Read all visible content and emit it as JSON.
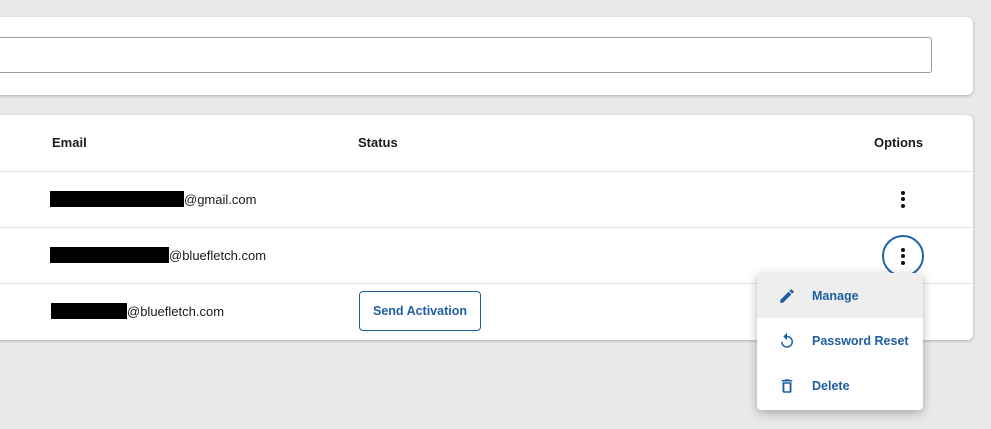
{
  "search": {
    "value": "",
    "placeholder": ""
  },
  "table": {
    "headers": {
      "email": "Email",
      "status": "Status",
      "options": "Options"
    },
    "rows": [
      {
        "email_domain": "@gmail.com",
        "status": ""
      },
      {
        "email_domain": "@bluefletch.com",
        "status": ""
      },
      {
        "email_domain": "@bluefletch.com",
        "status_action": "Send Activation"
      }
    ]
  },
  "options_menu": {
    "items": [
      {
        "label": "Manage",
        "icon": "pencil-icon"
      },
      {
        "label": "Password Reset",
        "icon": "reset-icon"
      },
      {
        "label": "Delete",
        "icon": "trash-icon"
      }
    ]
  },
  "colors": {
    "accent": "#1f5fa0",
    "focus_ring": "#1f63ad",
    "background": "#e9e9e9"
  }
}
